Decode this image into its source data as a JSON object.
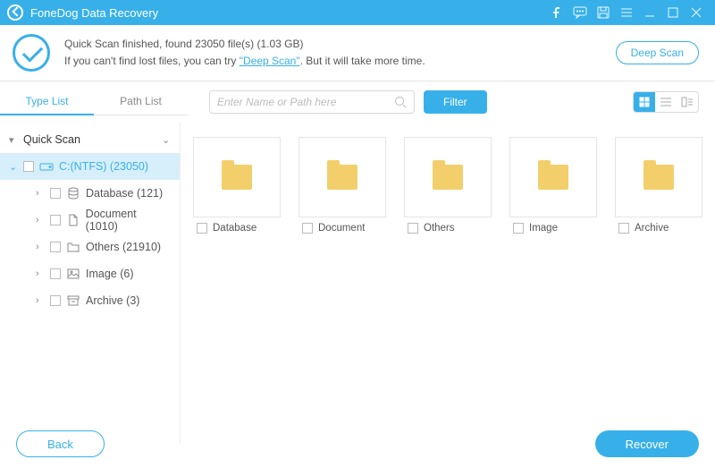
{
  "app": {
    "title": "FoneDog Data Recovery"
  },
  "info": {
    "line1_a": "Quick Scan finished, found ",
    "line1_b": " file(s) (",
    "line1_c": ")",
    "file_count": "23050",
    "size": "1.03 GB",
    "line2_a": "If you can't find lost files, you can try ",
    "deep_link": "\"Deep Scan\"",
    "line2_b": ". But it will take more time.",
    "deep_btn": "Deep Scan"
  },
  "tabs": {
    "type": "Type List",
    "path": "Path List"
  },
  "search": {
    "placeholder": "Enter Name or Path here"
  },
  "filter": "Filter",
  "tree": {
    "root": "Quick Scan",
    "drive": "C:(NTFS) (23050)",
    "items": [
      {
        "label": "Database (121)"
      },
      {
        "label": "Document (1010)"
      },
      {
        "label": "Others (21910)"
      },
      {
        "label": "Image (6)"
      },
      {
        "label": "Archive (3)"
      }
    ]
  },
  "grid": [
    {
      "label": "Database"
    },
    {
      "label": "Document"
    },
    {
      "label": "Others"
    },
    {
      "label": "Image"
    },
    {
      "label": "Archive"
    }
  ],
  "footer": {
    "back": "Back",
    "recover": "Recover"
  }
}
